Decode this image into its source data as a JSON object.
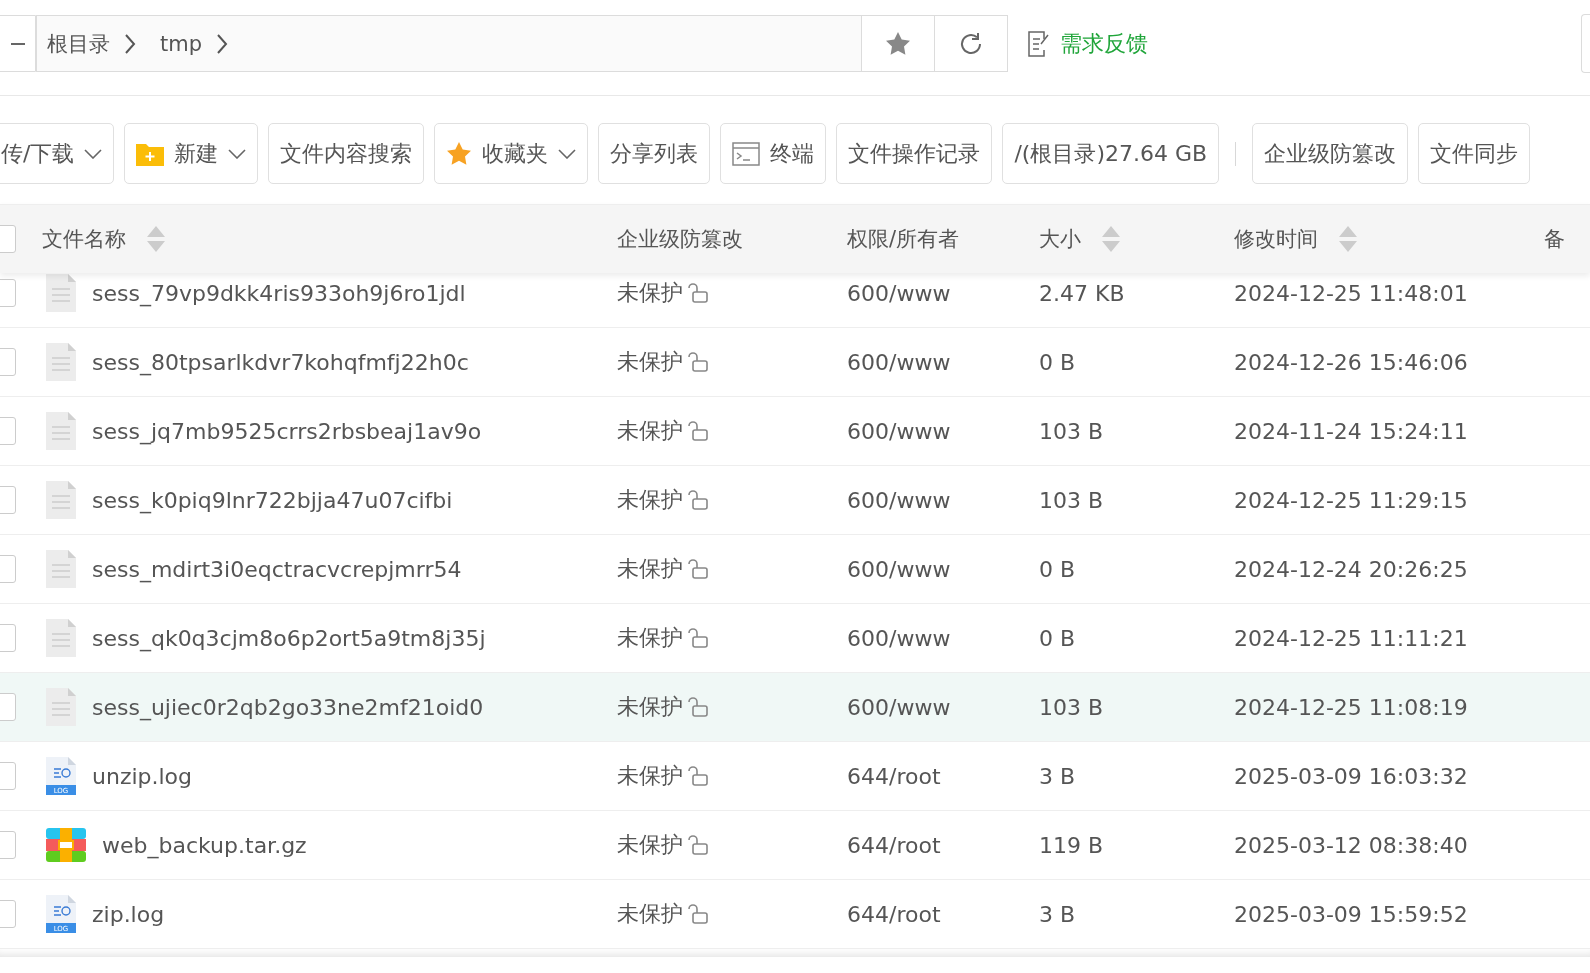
{
  "nav": {
    "breadcrumbs": [
      {
        "label": "根目录"
      },
      {
        "label": "tmp"
      }
    ],
    "feedback": "需求反馈"
  },
  "toolbar": {
    "main": [
      {
        "label": "传/下载",
        "kind": "plain",
        "menu": true
      },
      {
        "label": "新建",
        "kind": "folder",
        "menu": true
      },
      {
        "label": "文件内容搜索",
        "kind": "plain",
        "menu": false
      },
      {
        "label": "收藏夹",
        "kind": "star",
        "menu": true
      },
      {
        "label": "分享列表",
        "kind": "plain",
        "menu": false
      },
      {
        "label": "终端",
        "kind": "terminal",
        "menu": false
      },
      {
        "label": "文件操作记录",
        "kind": "plain",
        "menu": false
      },
      {
        "label": "/(根目录)27.64 GB",
        "kind": "plain",
        "menu": false
      }
    ],
    "extra": [
      {
        "label": "企业级防篡改",
        "menu": false
      },
      {
        "label": "文件同步",
        "menu": false
      }
    ]
  },
  "table": {
    "all_checked": false,
    "columns": [
      {
        "label": "文件名称",
        "sortable": true
      },
      {
        "label": "企业级防篡改",
        "sortable": false
      },
      {
        "label": "权限/所有者",
        "sortable": false
      },
      {
        "label": "大小",
        "sortable": true
      },
      {
        "label": "修改时间",
        "sortable": true
      },
      {
        "label": "备",
        "sortable": false
      }
    ],
    "rows": [
      {
        "name": "sess_79vp9dkk4ris933oh9j6ro1jdl",
        "kind": "text",
        "protection": "未保护",
        "permission": "600/www",
        "size": "2.47 KB",
        "modified": "2024-12-25 11:48:01",
        "checked": false,
        "selected": false
      },
      {
        "name": "sess_80tpsarlkdvr7kohqfmfj22h0c",
        "kind": "text",
        "protection": "未保护",
        "permission": "600/www",
        "size": "0 B",
        "modified": "2024-12-26 15:46:06",
        "checked": false,
        "selected": false
      },
      {
        "name": "sess_jq7mb9525crrs2rbsbeaj1av9o",
        "kind": "text",
        "protection": "未保护",
        "permission": "600/www",
        "size": "103 B",
        "modified": "2024-11-24 15:24:11",
        "checked": false,
        "selected": false
      },
      {
        "name": "sess_k0piq9lnr722bjja47u07cifbi",
        "kind": "text",
        "protection": "未保护",
        "permission": "600/www",
        "size": "103 B",
        "modified": "2024-12-25 11:29:15",
        "checked": false,
        "selected": false
      },
      {
        "name": "sess_mdirt3i0eqctracvcrepjmrr54",
        "kind": "text",
        "protection": "未保护",
        "permission": "600/www",
        "size": "0 B",
        "modified": "2024-12-24 20:26:25",
        "checked": false,
        "selected": false
      },
      {
        "name": "sess_qk0q3cjm8o6p2ort5a9tm8j35j",
        "kind": "text",
        "protection": "未保护",
        "permission": "600/www",
        "size": "0 B",
        "modified": "2024-12-25 11:11:21",
        "checked": false,
        "selected": false
      },
      {
        "name": "sess_ujiec0r2qb2go33ne2mf21oid0",
        "kind": "text",
        "protection": "未保护",
        "permission": "600/www",
        "size": "103 B",
        "modified": "2024-12-25 11:08:19",
        "checked": false,
        "selected": true
      },
      {
        "name": "unzip.log",
        "kind": "log",
        "icon_label": "LOG",
        "protection": "未保护",
        "permission": "644/root",
        "size": "3 B",
        "modified": "2025-03-09 16:03:32",
        "checked": false,
        "selected": false
      },
      {
        "name": "web_backup.tar.gz",
        "kind": "archive",
        "protection": "未保护",
        "permission": "644/root",
        "size": "119 B",
        "modified": "2025-03-12 08:38:40",
        "checked": false,
        "selected": false
      },
      {
        "name": "zip.log",
        "kind": "log",
        "icon_label": "LOG",
        "protection": "未保护",
        "permission": "644/root",
        "size": "3 B",
        "modified": "2025-03-09 15:59:52",
        "checked": false,
        "selected": false
      }
    ]
  }
}
